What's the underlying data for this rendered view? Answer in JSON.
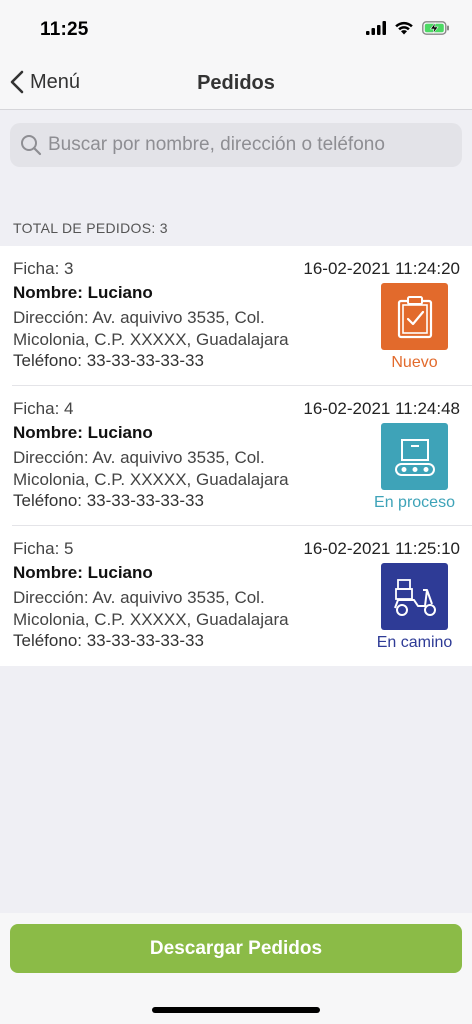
{
  "status_bar": {
    "time": "11:25",
    "icons": [
      "signal-icon",
      "wifi-icon",
      "battery-charging-icon"
    ]
  },
  "nav": {
    "back_label": "Menú",
    "title": "Pedidos"
  },
  "search": {
    "placeholder": "Buscar por nombre, dirección o teléfono",
    "value": ""
  },
  "section": {
    "header": "TOTAL DE PEDIDOS: 3"
  },
  "orders": [
    {
      "ficha": "Ficha: 3",
      "datetime": "16-02-2021 11:24:20",
      "name": "Nombre: Luciano",
      "address": "Dirección: Av. aquivivo 3535, Col. Micolonia, C.P. XXXXX, Guadalajara",
      "phone": "Teléfono: 33-33-33-33-33",
      "status": "Nuevo",
      "status_icon": "clipboard-check-icon",
      "status_color": "#e26a2c"
    },
    {
      "ficha": "Ficha: 4",
      "datetime": "16-02-2021 11:24:48",
      "name": "Nombre: Luciano",
      "address": "Dirección: Av. aquivivo 3535, Col. Micolonia, C.P. XXXXX, Guadalajara",
      "phone": "Teléfono: 33-33-33-33-33",
      "status": "En proceso",
      "status_icon": "conveyor-box-icon",
      "status_color": "#3ea3b8"
    },
    {
      "ficha": "Ficha: 5",
      "datetime": "16-02-2021 11:25:10",
      "name": "Nombre: Luciano",
      "address": "Dirección: Av. aquivivo 3535, Col. Micolonia, C.P. XXXXX, Guadalajara",
      "phone": "Teléfono: 33-33-33-33-33",
      "status": "En camino",
      "status_icon": "delivery-scooter-icon",
      "status_color": "#2e3b96"
    }
  ],
  "footer": {
    "download_label": "Descargar Pedidos",
    "button_color": "#8bbb47"
  }
}
